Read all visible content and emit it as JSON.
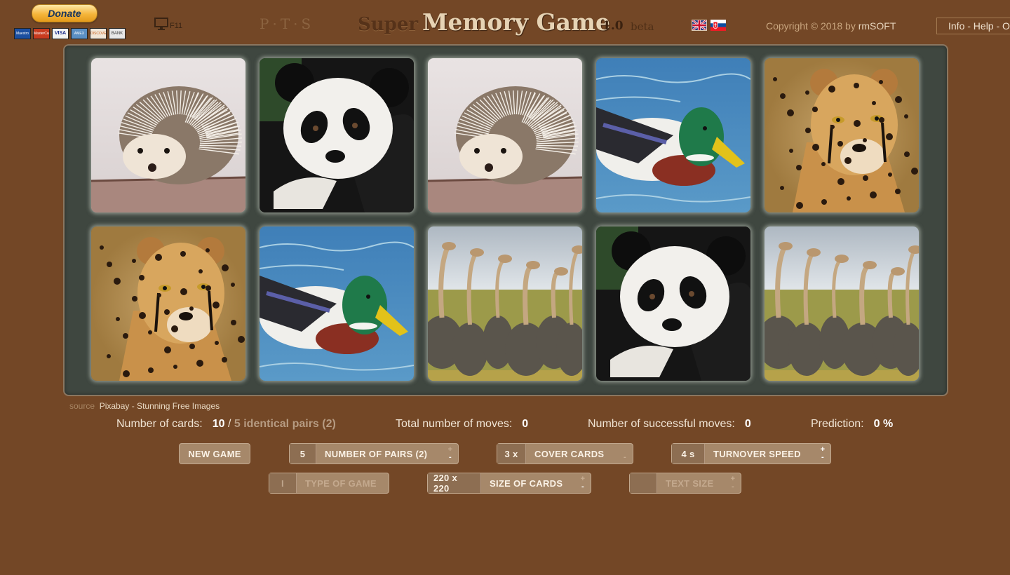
{
  "header": {
    "donate_label": "Donate",
    "payment_cards": [
      "Maestro",
      "MasterCard",
      "VISA",
      "AMEX",
      "DISCOVER",
      "BANK"
    ],
    "fullscreen_key": "F11",
    "pts_logo": "P·T·S",
    "title_prefix": "Super",
    "title": "Memory Game",
    "version": "1.0",
    "version_tag": "beta",
    "languages": [
      "English",
      "Slovak"
    ],
    "copyright": "Copyright © 2018 by",
    "copyright_owner": "rmSOFT",
    "info_help": "Info - Help - O"
  },
  "board": {
    "background_color": "#3f4740",
    "cards": [
      {
        "animal": "hedgehog"
      },
      {
        "animal": "panda"
      },
      {
        "animal": "hedgehog"
      },
      {
        "animal": "duck"
      },
      {
        "animal": "cheetah"
      },
      {
        "animal": "cheetah"
      },
      {
        "animal": "duck"
      },
      {
        "animal": "ostrich"
      },
      {
        "animal": "panda"
      },
      {
        "animal": "ostrich"
      }
    ]
  },
  "source": {
    "label": "source",
    "text": "Pixabay - Stunning Free Images"
  },
  "stats": {
    "cards_label": "Number of cards:",
    "cards_value": "10",
    "cards_sep": "/",
    "pairs_text": "5 identical pairs (2)",
    "moves_label": "Total number of moves:",
    "moves_value": "0",
    "success_label": "Number of successful moves:",
    "success_value": "0",
    "prediction_label": "Prediction:",
    "prediction_value": "0 %"
  },
  "controls": {
    "new_game": "NEW GAME",
    "pairs": {
      "value": "5",
      "label": "NUMBER OF PAIRS (2)"
    },
    "cover": {
      "value": "3 x",
      "label": "COVER CARDS"
    },
    "speed": {
      "value": "4 s",
      "label": "TURNOVER SPEED"
    },
    "game_type": {
      "value": "I",
      "label": "TYPE OF GAME"
    },
    "card_size": {
      "value": "220 x 220",
      "label": "SIZE OF CARDS"
    },
    "text_size": {
      "value": "",
      "label": "TEXT SIZE"
    },
    "plus": "+",
    "minus": "-"
  },
  "colors": {
    "background": "#734726",
    "accent": "#a6886a",
    "title": "#e6d3b4"
  }
}
